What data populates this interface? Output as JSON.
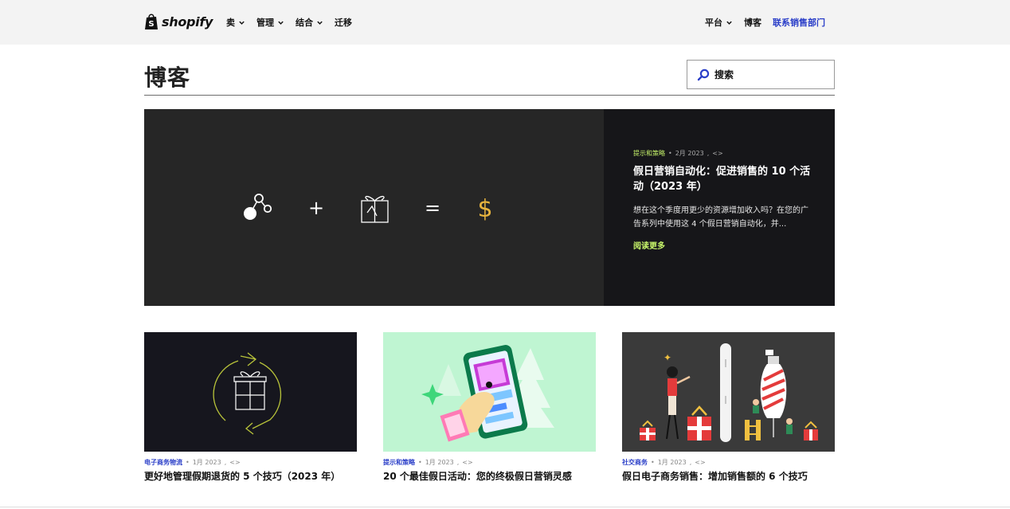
{
  "brand": {
    "name": "shopify"
  },
  "nav": {
    "left": [
      {
        "label": "卖"
      },
      {
        "label": "管理"
      },
      {
        "label": "结合"
      },
      {
        "label": "迁移"
      }
    ],
    "right": {
      "platform": "平台",
      "blog": "博客",
      "contact": "联系销售部门"
    }
  },
  "page": {
    "title": "博客"
  },
  "search": {
    "placeholder": "搜索"
  },
  "hero": {
    "category": "提示和策略",
    "date": "2月 2023",
    "extra": "<>",
    "title": "假日营销自动化：促进销售的 10 个活动（2023 年）",
    "excerpt": "想在这个季度用更少的资源增加收入吗？在您的广告系列中使用这 4 个假日营销自动化，并...",
    "more": "阅读更多",
    "equation": {
      "plus": "+",
      "equals": "=",
      "dollar": "$"
    }
  },
  "cards": [
    {
      "category": "电子商务物流",
      "date": "1月 2023",
      "extra": "<>",
      "title": "更好地管理假期退货的 5 个技巧（2023 年）"
    },
    {
      "category": "提示和策略",
      "date": "1月 2023",
      "extra": "<>",
      "title": "20 个最佳假日活动：您的终极假日营销灵感"
    },
    {
      "category": "社交商务",
      "date": "1月 2023",
      "extra": "<>",
      "title": "假日电子商务销售：增加销售额的 6 个技巧"
    }
  ],
  "colors": {
    "accent_green": "#c6f36a",
    "link_blue": "#2a3ec8",
    "dark": "#161619"
  }
}
